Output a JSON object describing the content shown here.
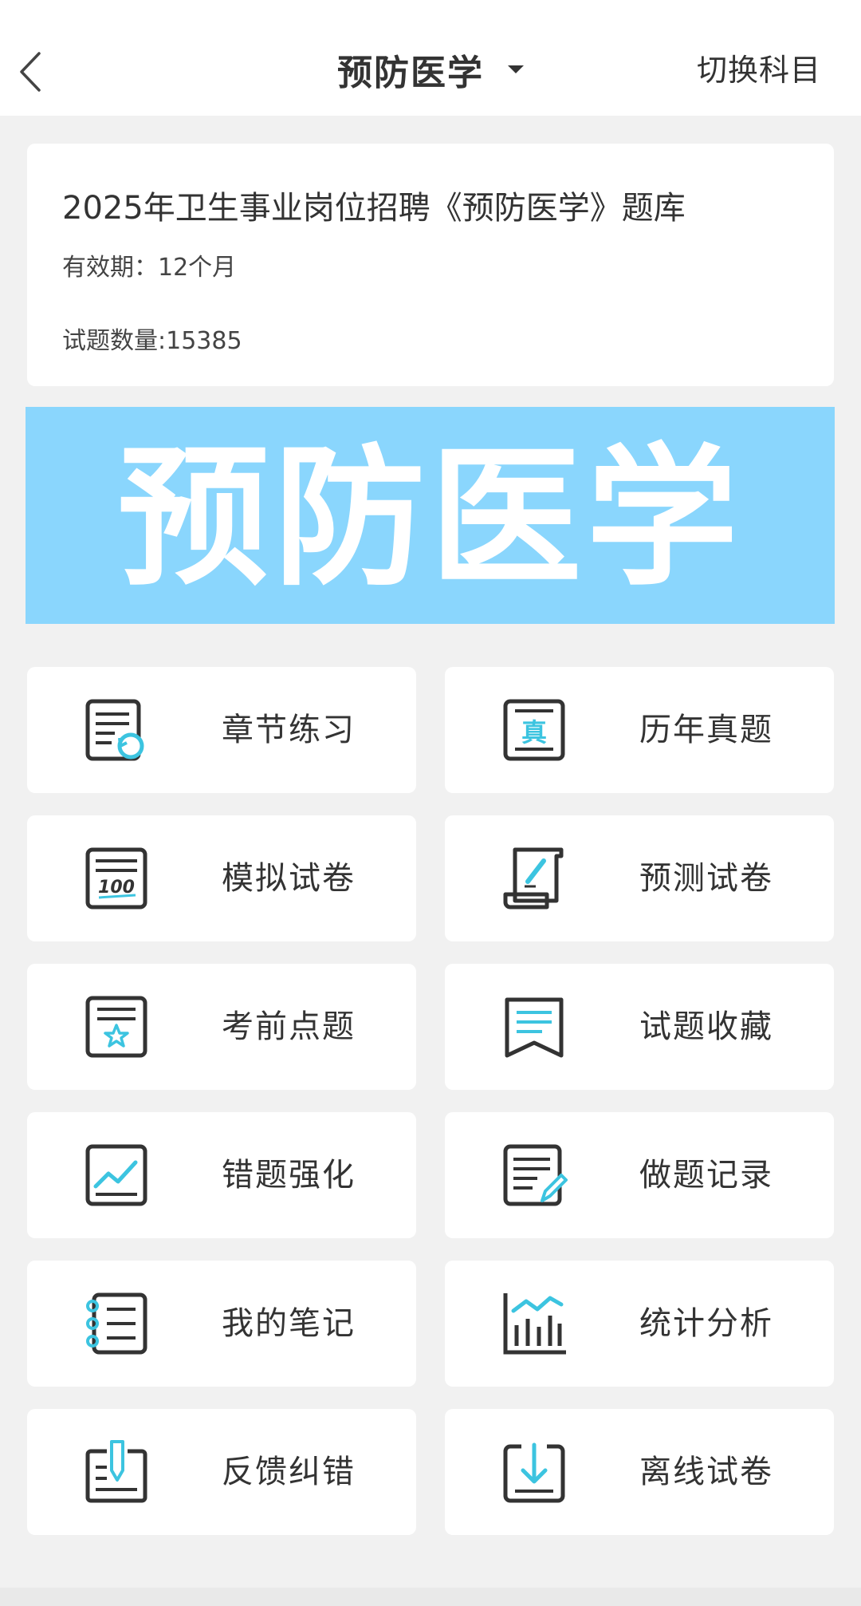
{
  "header": {
    "title": "预防医学",
    "switch_label": "切换科目"
  },
  "info": {
    "title": "2025年卫生事业岗位招聘《预防医学》题库",
    "validity": "有效期：12个月",
    "count": "试题数量:15385"
  },
  "banner": {
    "text": "预防医学"
  },
  "colors": {
    "accent": "#3cc4e0",
    "icon_dark": "#333333",
    "banner_bg": "#8ad6fd"
  },
  "menu": [
    {
      "label": "章节练习",
      "icon": "chapter-practice-icon"
    },
    {
      "label": "历年真题",
      "icon": "past-exams-icon"
    },
    {
      "label": "模拟试卷",
      "icon": "mock-paper-icon"
    },
    {
      "label": "预测试卷",
      "icon": "forecast-paper-icon"
    },
    {
      "label": "考前点题",
      "icon": "pre-exam-tips-icon"
    },
    {
      "label": "试题收藏",
      "icon": "favorites-icon"
    },
    {
      "label": "错题强化",
      "icon": "wrong-questions-icon"
    },
    {
      "label": "做题记录",
      "icon": "practice-record-icon"
    },
    {
      "label": "我的笔记",
      "icon": "notes-icon"
    },
    {
      "label": "统计分析",
      "icon": "statistics-icon"
    },
    {
      "label": "反馈纠错",
      "icon": "feedback-icon"
    },
    {
      "label": "离线试卷",
      "icon": "offline-download-icon"
    }
  ]
}
